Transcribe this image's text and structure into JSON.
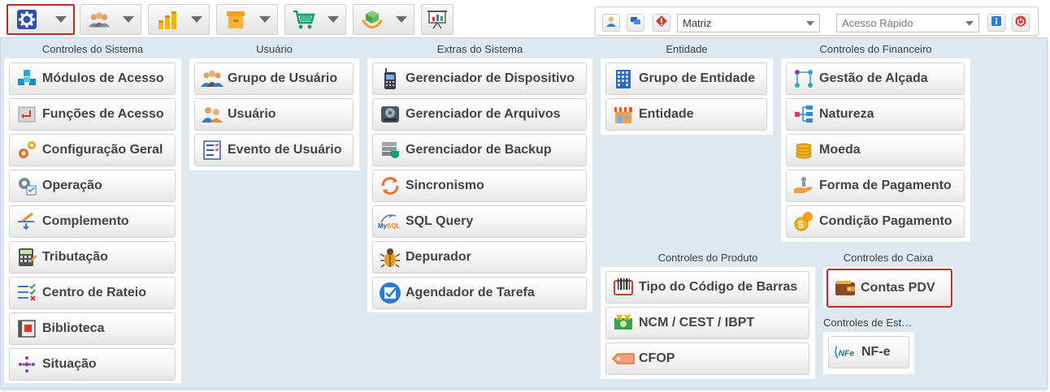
{
  "toolbar": {
    "modules": [
      {
        "icon": "gear-icon",
        "active": true
      },
      {
        "icon": "users-icon",
        "active": false
      },
      {
        "icon": "coins-chart-icon",
        "active": false
      },
      {
        "icon": "box-icon",
        "active": false
      },
      {
        "icon": "cart-icon",
        "active": false
      },
      {
        "icon": "hand-cube-icon",
        "active": false
      }
    ],
    "report_icon": "presentation-icon"
  },
  "top_right": {
    "company_select": "Matriz",
    "quick_access_placeholder": "Acesso Rápido",
    "icons": [
      "user-icon",
      "chat-icon",
      "alert-icon",
      "info-icon",
      "power-icon"
    ]
  },
  "groups": {
    "sistema": {
      "title": "Controles do Sistema",
      "items": [
        {
          "label": "Módulos de Acesso",
          "icon": "cubes-icon"
        },
        {
          "label": "Funções de Acesso",
          "icon": "enter-key-icon"
        },
        {
          "label": "Configuração Geral",
          "icon": "gears-icon"
        },
        {
          "label": "Operação",
          "icon": "gear-checklist-icon"
        },
        {
          "label": "Complemento",
          "icon": "brush-arrow-icon"
        },
        {
          "label": "Tributação",
          "icon": "calculator-icon"
        },
        {
          "label": "Centro de Rateio",
          "icon": "check-list-icon"
        },
        {
          "label": "Biblioteca",
          "icon": "library-icon"
        },
        {
          "label": "Situação",
          "icon": "dots-icon"
        }
      ]
    },
    "usuario": {
      "title": "Usuário",
      "items": [
        {
          "label": "Grupo de Usuário",
          "icon": "user-group-icon"
        },
        {
          "label": "Usuário",
          "icon": "users-pair-icon"
        },
        {
          "label": "Evento de Usuário",
          "icon": "event-list-icon"
        }
      ]
    },
    "extras": {
      "title": "Extras do Sistema",
      "items": [
        {
          "label": "Gerenciador de Dispositivo",
          "icon": "device-icon"
        },
        {
          "label": "Gerenciador de Arquivos",
          "icon": "hard-disk-icon"
        },
        {
          "label": "Gerenciador de Backup",
          "icon": "backup-icon"
        },
        {
          "label": "Sincronismo",
          "icon": "sync-icon"
        },
        {
          "label": "SQL Query",
          "icon": "mysql-icon"
        },
        {
          "label": "Depurador",
          "icon": "bug-icon"
        },
        {
          "label": "Agendador de Tarefa",
          "icon": "scheduler-check-icon"
        }
      ]
    },
    "entidade": {
      "title": "Entidade",
      "items": [
        {
          "label": "Grupo de Entidade",
          "icon": "building-icon"
        },
        {
          "label": "Entidade",
          "icon": "store-icon"
        }
      ]
    },
    "financeiro": {
      "title": "Controles do Financeiro",
      "items": [
        {
          "label": "Gestão de Alçada",
          "icon": "workflow-icon"
        },
        {
          "label": "Natureza",
          "icon": "hierarchy-icon"
        },
        {
          "label": "Moeda",
          "icon": "coins-icon"
        },
        {
          "label": "Forma de Pagamento",
          "icon": "hand-coin-icon"
        },
        {
          "label": "Condição Pagamento",
          "icon": "coin-number-icon"
        }
      ]
    },
    "produto": {
      "title": "Controles do Produto",
      "items": [
        {
          "label": "Tipo do Código de Barras",
          "icon": "barcode-icon"
        },
        {
          "label": "NCM / CEST / IBPT",
          "icon": "banknote-icon"
        },
        {
          "label": "CFOP",
          "icon": "tag-icon"
        }
      ]
    },
    "caixa": {
      "title": "Controles do Caixa",
      "items": [
        {
          "label": "Contas PDV",
          "icon": "wallet-icon"
        }
      ]
    },
    "estoque": {
      "title": "Controles de Est…",
      "items": [
        {
          "label": "NF-e",
          "icon": "nfe-icon"
        }
      ]
    }
  },
  "colors": {
    "panel_bg": "#dde8f0",
    "active_border": "#c0282d",
    "label_text": "#444444"
  }
}
